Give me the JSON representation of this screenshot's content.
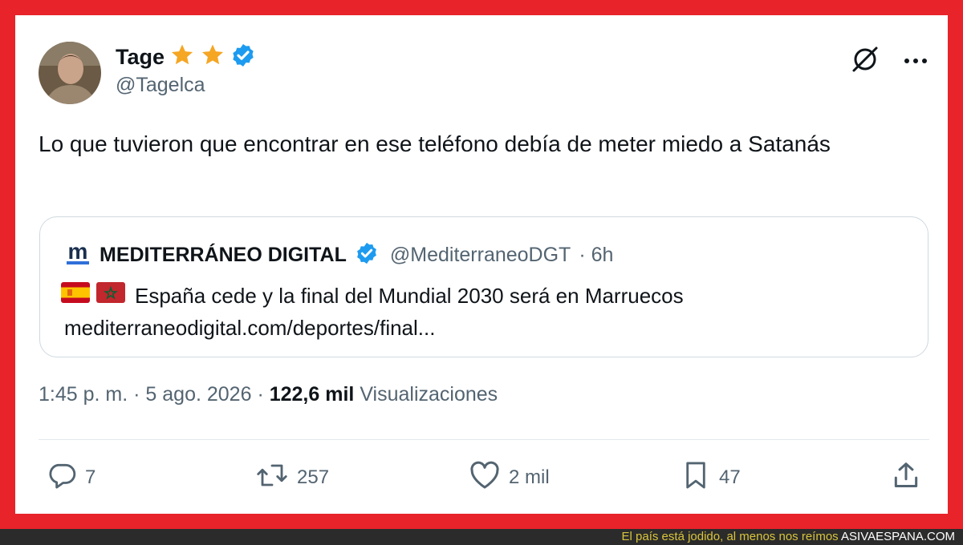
{
  "tweet": {
    "author_name": "Tage",
    "author_handle": "@Tagelca",
    "text": "Lo que tuvieron que encontrar en ese teléfono debía de meter miedo a Satanás",
    "time": "1:45 p. m.",
    "separator1": "·",
    "date": "5 ago. 2026",
    "separator2": "·",
    "views_count": "122,6 mil",
    "views_label": "Visualizaciones",
    "icons": {
      "badges": [
        "star-icon",
        "star-icon",
        "verified-icon"
      ],
      "menu": [
        "grok-icon",
        "more-icon"
      ]
    }
  },
  "quote": {
    "logo_letter": "m",
    "name": "MEDITERRÁNEO DIGITAL",
    "handle": "@MediterraneoDGT",
    "time": "· 6h",
    "text": "España cede y la final del Mundial 2030 será en Marruecos",
    "link": "mediterraneodigital.com/deportes/final...",
    "flags": [
      "spain-flag-icon",
      "morocco-flag-icon"
    ]
  },
  "actions": {
    "replies": "7",
    "retweets": "257",
    "likes": "2 mil",
    "bookmarks": "47"
  },
  "footer": {
    "tagline": "El país está jodido, al menos nos reímos",
    "site": "ASIVAESPANA.COM"
  },
  "colors": {
    "frame": "#e8232a",
    "verified": "#1d9bf0",
    "star": "#f5a623",
    "text": "#0f1419",
    "muted": "#536471"
  }
}
